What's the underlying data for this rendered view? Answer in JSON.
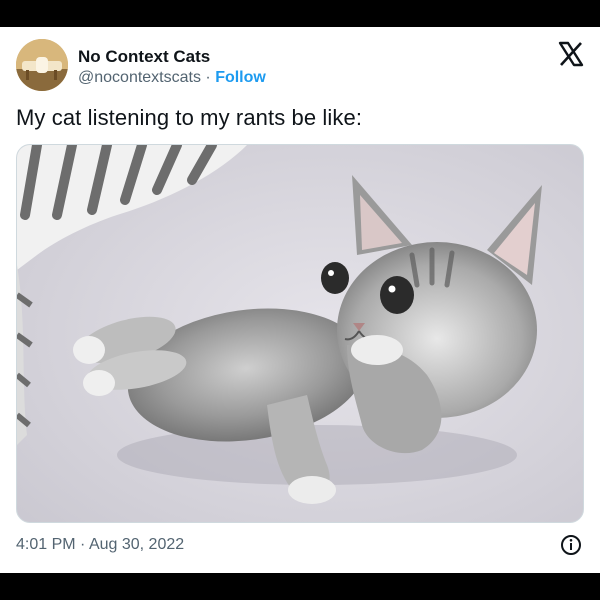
{
  "tweet": {
    "author_name": "No Context Cats",
    "handle": "@nocontextscats",
    "separator": " · ",
    "follow_label": "Follow",
    "text": "My cat listening to my rants be like:",
    "time": "4:01 PM",
    "date_separator": " · ",
    "date": "Aug 30, 2022"
  },
  "icons": {
    "close": "x-logo-icon",
    "info": "info-icon"
  },
  "colors": {
    "link": "#1d9bf0",
    "secondary_text": "#536471",
    "primary_text": "#0f1419"
  }
}
